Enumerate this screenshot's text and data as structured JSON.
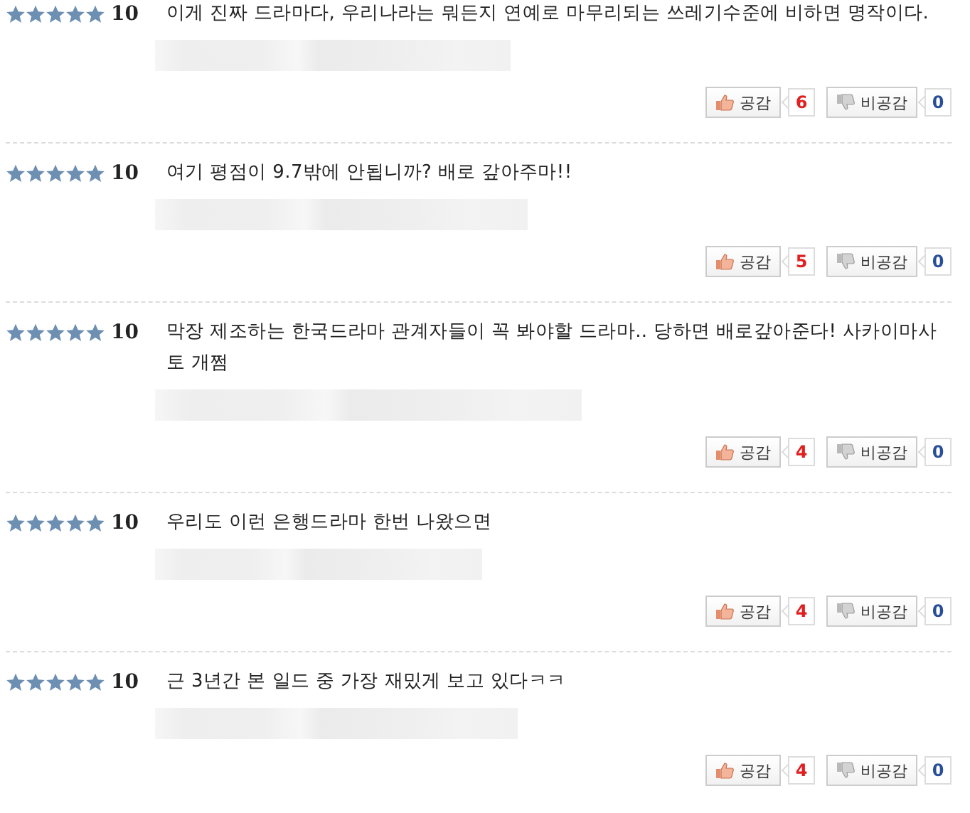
{
  "reviews": [
    {
      "stars": 5,
      "score": "10",
      "text": "이게 진짜 드라마다, 우리나라는 뭐든지 연예로 마무리되는 쓰레기수준에 비하면 명작이다.",
      "agree": {
        "label": "공감",
        "count": "6"
      },
      "disagree": {
        "label": "비공감",
        "count": "0"
      }
    },
    {
      "stars": 5,
      "score": "10",
      "text": "여기 평점이 9.7밖에 안됩니까? 배로 갚아주마!!",
      "agree": {
        "label": "공감",
        "count": "5"
      },
      "disagree": {
        "label": "비공감",
        "count": "0"
      }
    },
    {
      "stars": 5,
      "score": "10",
      "text": "막장 제조하는 한국드라마 관계자들이 꼭 봐야할 드라마.. 당하면 배로갚아준다! 사카이마사토 개쩜",
      "agree": {
        "label": "공감",
        "count": "4"
      },
      "disagree": {
        "label": "비공감",
        "count": "0"
      }
    },
    {
      "stars": 5,
      "score": "10",
      "text": "우리도 이런 은행드라마 한번 나왔으면",
      "agree": {
        "label": "공감",
        "count": "4"
      },
      "disagree": {
        "label": "비공감",
        "count": "0"
      }
    },
    {
      "stars": 5,
      "score": "10",
      "text": "근 3년간 본 일드 중 가장 재밌게 보고 있다ㅋㅋ",
      "agree": {
        "label": "공감",
        "count": "4"
      },
      "disagree": {
        "label": "비공감",
        "count": "0"
      }
    }
  ]
}
